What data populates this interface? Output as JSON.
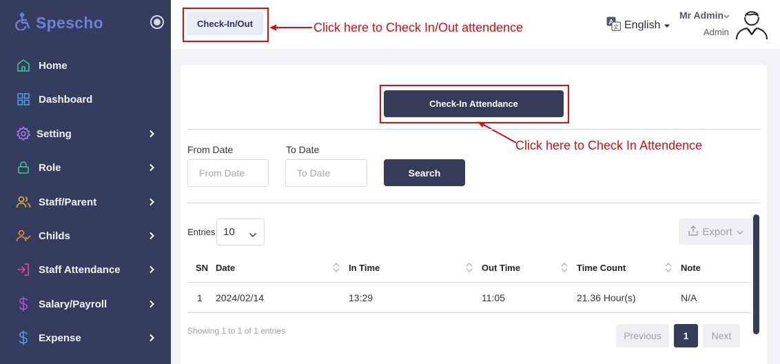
{
  "brand": {
    "name": "Spescho"
  },
  "sidebar": {
    "items": [
      {
        "label": "Home",
        "icon": "home-icon",
        "has_chevron": false,
        "color": "#3ec98e"
      },
      {
        "label": "Dashboard",
        "icon": "dashboard-grid-icon",
        "has_chevron": false,
        "color": "#4a9cf0"
      },
      {
        "label": "Setting",
        "icon": "gear-icon",
        "has_chevron": true,
        "color": "#a77bf3"
      },
      {
        "label": "Role",
        "icon": "lock-icon",
        "has_chevron": true,
        "color": "#3ec98e"
      },
      {
        "label": "Staff/Parent",
        "icon": "users-icon",
        "has_chevron": true,
        "color": "#f1b33b"
      },
      {
        "label": "Childs",
        "icon": "user-check-icon",
        "has_chevron": true,
        "color": "#f08a3c"
      },
      {
        "label": "Staff Attendance",
        "icon": "sign-in-icon",
        "has_chevron": true,
        "color": "#e8479a"
      },
      {
        "label": "Salary/Payroll",
        "icon": "dollar-icon",
        "has_chevron": true,
        "color": "#b44fe2"
      },
      {
        "label": "Expense",
        "icon": "dollar-icon",
        "has_chevron": true,
        "color": "#4a9cf0"
      }
    ]
  },
  "header": {
    "checkio_label": "Check-In/Out",
    "checkio_annotation": "Click here to Check In/Out attendence",
    "language": "English",
    "user_name": "Mr Admin",
    "user_role": "Admin"
  },
  "main": {
    "checkin_label": "Check-In Attendance",
    "checkin_annotation": "Click here to Check In Attendence",
    "filters": {
      "from_label": "From Date",
      "from_placeholder": "From Date",
      "to_label": "To Date",
      "to_placeholder": "To Date",
      "search_label": "Search"
    },
    "entries_label": "Entries",
    "entries_value": "10",
    "export_label": "Export",
    "table": {
      "headers": [
        "SN",
        "Date",
        "In Time",
        "Out Time",
        "Time Count",
        "Note"
      ],
      "rows": [
        [
          "1",
          "2024/02/14",
          "13:29",
          "11:05",
          "21.36 Hour(s)",
          "N/A"
        ]
      ]
    },
    "info": "Showing 1 to 1 of 1 entries",
    "pagination": {
      "prev": "Previous",
      "current": "1",
      "next": "Next"
    }
  },
  "colors": {
    "sidebar_bg": "#343d5e",
    "primary_button": "#353c5a",
    "annotation_red": "#d60e0e",
    "brand_blue": "#6d7fd8"
  }
}
